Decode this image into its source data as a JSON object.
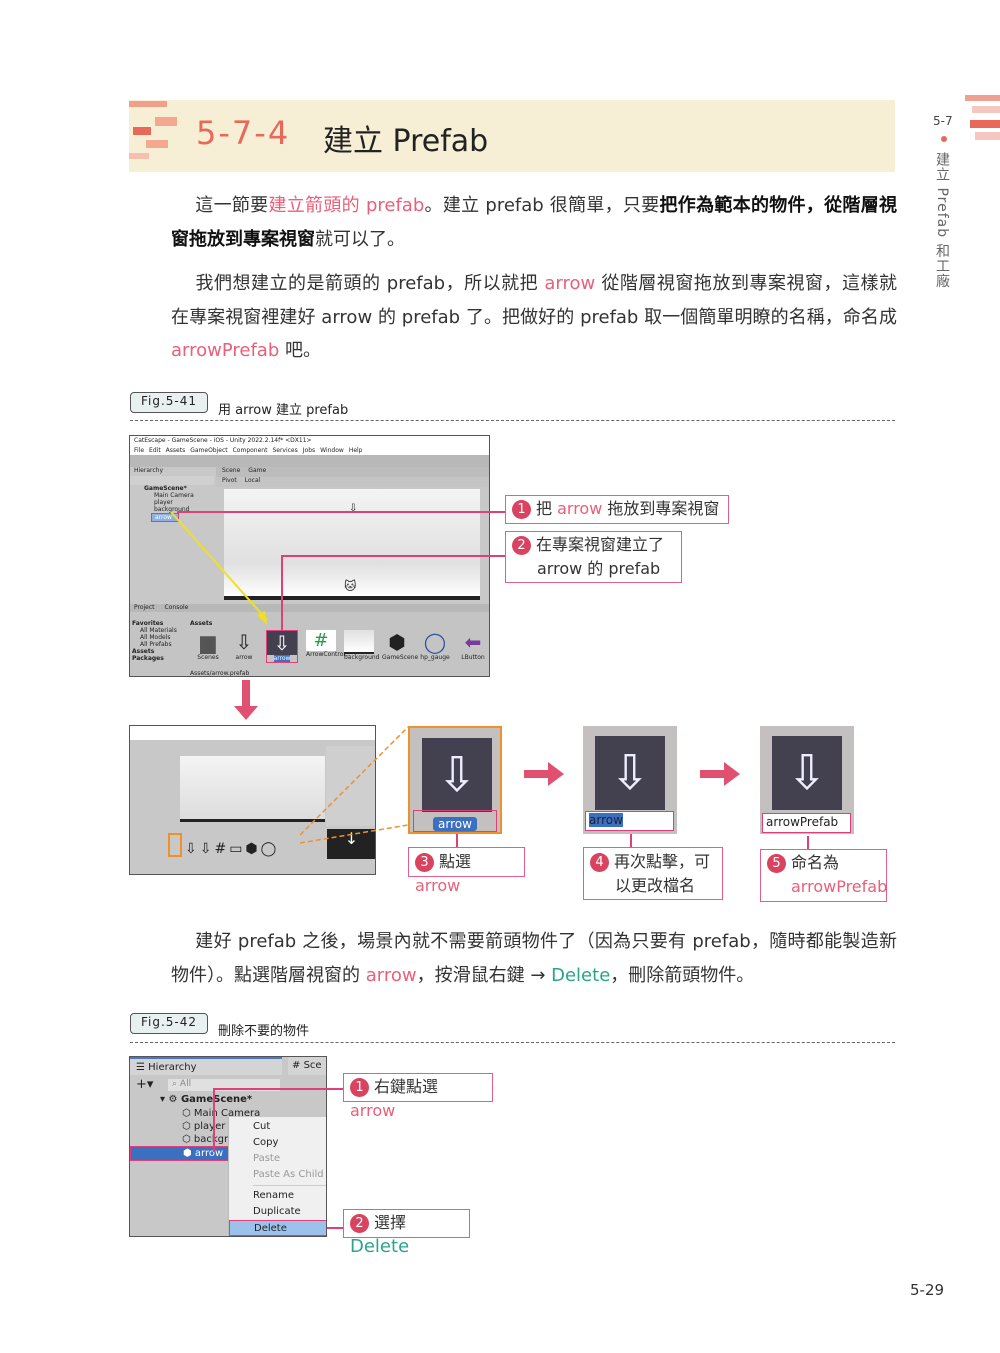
{
  "section": {
    "number": "5-7-4",
    "title": "建立 Prefab"
  },
  "side_tab": {
    "number": "5-7",
    "title": "建立 Prefab 和工廠"
  },
  "paragraphs": {
    "p1": [
      "這一節要",
      "建立箭頭的 prefab",
      "。建立 prefab 很簡單，只要",
      "把作為範本的物件，從階層視窗拖放到專案視窗",
      "就可以了。"
    ],
    "p2": [
      "我們想建立的是箭頭的 prefab，所以就把 ",
      "arrow",
      " 從階層視窗拖放到專案視窗，這樣就在專案視窗裡建好 arrow 的 prefab 了。把做好的 prefab 取一個簡單明瞭的名稱，命名成 ",
      "arrowPrefab",
      " 吧。"
    ],
    "p3": [
      "建好 prefab 之後，場景內就不需要箭頭物件了（因為只要有 prefab，隨時都能製造新物件）。點選階層視窗的 ",
      "arrow",
      "，按滑鼠右鍵 → ",
      "Delete",
      "，刪除箭頭物件。"
    ]
  },
  "fig41": {
    "label": "Fig.5-41",
    "caption": "用 arrow 建立 prefab",
    "unity": {
      "title": "CatEscape - GameScene - iOS - Unity 2022.2.14f* <DX11>",
      "menu": [
        "File",
        "Edit",
        "Assets",
        "GameObject",
        "Component",
        "Services",
        "Jobs",
        "Window",
        "Help"
      ],
      "hierarchy_tab": "Hierarchy",
      "scene_tabs": [
        "Scene",
        "Game"
      ],
      "pivot": "Pivot",
      "local": "Local",
      "scene_root": "GameScene*",
      "objects": [
        "Main Camera",
        "player",
        "background",
        "arrow"
      ],
      "project_tabs": [
        "Project",
        "Console"
      ],
      "favorites": "Favorites",
      "favorite_items": [
        "All Materials",
        "All Models",
        "All Prefabs"
      ],
      "roots": [
        "Assets",
        "Packages"
      ],
      "assets_header": "Assets",
      "assets": [
        "Scenes",
        "arrow",
        "arrow",
        "ArrowControl...",
        "background",
        "GameScene",
        "hp_gauge",
        "LButton"
      ],
      "status_path": "Assets/arrow.prefab"
    },
    "callouts": [
      {
        "num": "1",
        "pre": "把 ",
        "hl": "arrow",
        "post": " 拖放到專案視窗"
      },
      {
        "num": "2",
        "line1": "在專案視窗建立了",
        "line2": "arrow 的 prefab"
      }
    ],
    "steps": [
      {
        "num": "3",
        "text": "點選 ",
        "hl": "arrow",
        "field": "arrow"
      },
      {
        "num": "4",
        "line1": "再次點擊，可",
        "line2": "以更改檔名",
        "field": "arrow"
      },
      {
        "num": "5",
        "line1": "命名為",
        "hl": "arrowPrefab",
        "field": "arrowPrefab"
      }
    ]
  },
  "fig42": {
    "label": "Fig.5-42",
    "caption": "刪除不要的物件",
    "hierarchy_tab": "Hierarchy",
    "scene_tab": "Sce",
    "search_placeholder": "All",
    "scene_root": "GameScene*",
    "objects": [
      "Main Camera",
      "player",
      "backgr",
      "arrow"
    ],
    "context_menu": [
      {
        "label": "Cut",
        "enabled": true
      },
      {
        "label": "Copy",
        "enabled": true
      },
      {
        "label": "Paste",
        "enabled": false
      },
      {
        "label": "Paste As Child",
        "enabled": false
      },
      {
        "label": "Rename",
        "enabled": true
      },
      {
        "label": "Duplicate",
        "enabled": true
      },
      {
        "label": "Delete",
        "enabled": true,
        "selected": true
      }
    ],
    "callouts": [
      {
        "num": "1",
        "pre": "右鍵點選 ",
        "hl": "arrow"
      },
      {
        "num": "2",
        "pre": "選擇 ",
        "hl": "Delete"
      }
    ]
  },
  "page_number": "5-29",
  "colors": {
    "accent": "#e8685a",
    "highlight": "#e8607a",
    "teal": "#2aa58a",
    "band": "#f6efd6",
    "callout_border": "#e0608a",
    "orange": "#f0902a"
  }
}
